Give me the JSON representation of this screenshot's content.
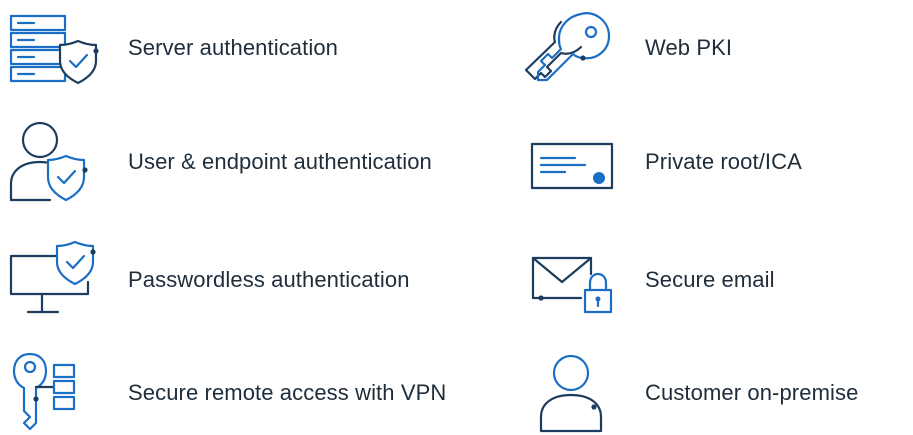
{
  "colors": {
    "icon_primary": "#1a6fc4",
    "icon_dark": "#1d3d5e",
    "text": "#1f2d3b",
    "background": "#ffffff"
  },
  "features": {
    "left": [
      {
        "label": "Server authentication",
        "icon": "server-shield-icon"
      },
      {
        "label": "User & endpoint authentication",
        "icon": "user-shield-icon"
      },
      {
        "label": "Passwordless authentication",
        "icon": "monitor-shield-icon"
      },
      {
        "label": "Secure remote access with VPN",
        "icon": "key-list-icon"
      }
    ],
    "right": [
      {
        "label": "Web PKI",
        "icon": "keys-icon"
      },
      {
        "label": "Private root/ICA",
        "icon": "certificate-icon"
      },
      {
        "label": "Secure email",
        "icon": "envelope-lock-icon"
      },
      {
        "label": "Customer on-premise",
        "icon": "customer-icon"
      }
    ]
  }
}
